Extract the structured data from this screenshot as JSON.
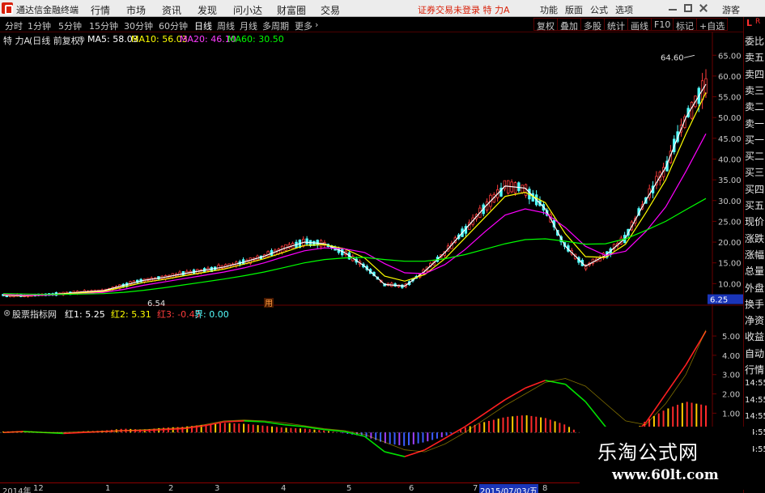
{
  "topbar": {
    "app_title": "通达信金融终端",
    "menus": [
      "行情",
      "市场",
      "资讯",
      "发现",
      "问小达",
      "财富圈",
      "交易"
    ],
    "notice": "证券交易未登录 特 力A",
    "right_menus": [
      "功能",
      "版面",
      "公式",
      "选项"
    ],
    "guest": "游客"
  },
  "periodbar": {
    "periods": [
      "分时",
      "1分钟",
      "5分钟",
      "15分钟",
      "30分钟",
      "60分钟",
      "日线",
      "周线",
      "月线",
      "多周期",
      "更多"
    ],
    "active": "日线",
    "more_arrow": "›",
    "right_buttons": [
      "复权",
      "叠加",
      "多股",
      "统计",
      "画线",
      "F10",
      "标记",
      "+自选"
    ],
    "corner": "L",
    "corner_sub": "R"
  },
  "chart_header": {
    "stock": "特 力A",
    "adj": "(日线 前复权)",
    "ma5": "MA5: 58.03",
    "ma10": "MA10: 56.03",
    "ma20": "MA20: 46.10",
    "ma60": "MA60: 30.50"
  },
  "indicator_header": {
    "name": "股票指标网",
    "red1": "红1: 5.25",
    "red2": "红2: 5.31",
    "red3": "红3: -0.43",
    "jie": "界: 0.00"
  },
  "price_axis": {
    "ticks": [
      "65.00",
      "60.00",
      "55.00",
      "50.00",
      "45.00",
      "40.00",
      "35.00",
      "30.00",
      "25.00",
      "20.00",
      "15.00",
      "10.00"
    ],
    "current": "6.25"
  },
  "indicator_axis": {
    "ticks": [
      "5.00",
      "4.00",
      "3.00",
      "2.00",
      "1.00"
    ]
  },
  "annotations": {
    "high": "64.60",
    "low": "6.54",
    "marker": "用"
  },
  "right_column": [
    "委比",
    "卖五",
    "卖四",
    "卖三",
    "卖二",
    "卖一",
    "买一",
    "买二",
    "买三",
    "买四",
    "买五",
    "现价",
    "涨跌",
    "涨幅",
    "总量",
    "外盘",
    "换手",
    "净资",
    "收益",
    "自动",
    "行情",
    "14:55",
    "14:55",
    "14:55",
    "14:55",
    "14:55"
  ],
  "x_axis": {
    "labels": [
      "2014年",
      "12",
      "1",
      "2",
      "3",
      "4",
      "5",
      "6",
      "7",
      "8"
    ],
    "cursor_date": "2015/07/03/五"
  },
  "watermark": {
    "cn": "乐淘公式网",
    "url": "www.60lt.com"
  },
  "colors": {
    "up": "#ff3c3c",
    "down": "#54ffff",
    "ma5": "#ffffff",
    "ma10": "#ffff00",
    "ma20": "#ff00ff",
    "ma60": "#00ff00",
    "ind_red": "#ff2020",
    "ind_green": "#00e000",
    "grid": "#6a0000"
  },
  "chart_data": [
    {
      "type": "candlestick",
      "title": "特 力A (日线 前复权)",
      "xlabel": "",
      "ylabel": "",
      "ylim": [
        5,
        67
      ],
      "x_labels": [
        "2014年",
        "12",
        "1",
        "2",
        "3",
        "4",
        "5",
        "6",
        "7",
        "8"
      ],
      "series": [
        {
          "name": "MA5",
          "values": [
            7.2,
            7.0,
            7.3,
            7.6,
            8.0,
            8.3,
            9.6,
            10.8,
            11.5,
            12.4,
            13.2,
            14.0,
            15.2,
            16.6,
            18.5,
            20.0,
            19.6,
            17.5,
            14.2,
            9.8,
            9.4,
            13.0,
            17.5,
            23.0,
            28.5,
            33.5,
            33.0,
            28.0,
            19.0,
            14.2,
            16.8,
            21.0,
            30.0,
            38.0,
            50.0,
            58.03
          ]
        },
        {
          "name": "MA10",
          "values": [
            7.3,
            7.1,
            7.2,
            7.5,
            7.8,
            8.1,
            9.2,
            10.3,
            11.0,
            11.9,
            12.7,
            13.5,
            14.7,
            16.0,
            17.6,
            19.2,
            19.4,
            18.4,
            16.2,
            11.8,
            10.6,
            12.2,
            16.0,
            21.0,
            26.0,
            31.0,
            32.0,
            29.5,
            22.0,
            16.5,
            16.3,
            19.5,
            27.0,
            35.0,
            46.0,
            56.03
          ]
        },
        {
          "name": "MA20",
          "values": [
            7.4,
            7.2,
            7.2,
            7.4,
            7.6,
            7.9,
            8.6,
            9.6,
            10.4,
            11.2,
            12.0,
            12.8,
            13.8,
            15.0,
            16.5,
            17.9,
            18.6,
            18.4,
            17.5,
            14.8,
            12.6,
            12.4,
            14.6,
            18.2,
            22.5,
            26.5,
            28.0,
            27.0,
            23.5,
            19.0,
            16.8,
            17.8,
            22.5,
            28.5,
            37.0,
            46.1
          ]
        },
        {
          "name": "MA60",
          "values": [
            7.6,
            7.5,
            7.4,
            7.4,
            7.5,
            7.6,
            7.9,
            8.4,
            9.0,
            9.7,
            10.4,
            11.1,
            11.9,
            12.8,
            13.9,
            15.0,
            15.8,
            16.2,
            16.3,
            15.8,
            15.4,
            15.4,
            16.0,
            17.0,
            18.3,
            19.6,
            20.6,
            20.8,
            20.2,
            19.5,
            19.6,
            20.8,
            22.8,
            25.0,
            27.8,
            30.5
          ]
        }
      ],
      "high_label": 64.6,
      "low_label": 6.54,
      "current": 6.25
    },
    {
      "type": "line",
      "title": "股票指标网",
      "xlabel": "",
      "ylabel": "",
      "ylim": [
        -1.5,
        5.8
      ],
      "series": [
        {
          "name": "红1",
          "values": [
            0.0,
            0.05,
            0.0,
            -0.05,
            0.0,
            0.05,
            0.1,
            0.1,
            0.15,
            0.2,
            0.35,
            0.55,
            0.6,
            0.55,
            0.4,
            0.3,
            0.15,
            0.05,
            -0.2,
            -1.0,
            -1.25,
            -0.9,
            -0.3,
            0.3,
            1.0,
            1.7,
            2.3,
            2.7,
            2.5,
            1.6,
            0.3,
            -0.5,
            0.5,
            2.0,
            3.5,
            5.25
          ]
        },
        {
          "name": "红2",
          "values": [
            0.0,
            0.05,
            0.0,
            0.0,
            0.05,
            0.05,
            0.1,
            0.15,
            0.2,
            0.25,
            0.4,
            0.6,
            0.65,
            0.6,
            0.5,
            0.35,
            0.2,
            0.1,
            -0.1,
            -0.5,
            -0.9,
            -1.0,
            -0.6,
            0.0,
            0.7,
            1.4,
            2.0,
            2.6,
            2.8,
            2.4,
            1.5,
            0.6,
            0.4,
            1.5,
            3.0,
            5.31
          ]
        },
        {
          "name": "界",
          "values": [
            0,
            0,
            0,
            0,
            0,
            0,
            0,
            0,
            0,
            0,
            0,
            0,
            0,
            0,
            0,
            0,
            0,
            0,
            0,
            0,
            0,
            0,
            0,
            0,
            0,
            0,
            0,
            0,
            0,
            0,
            0,
            0,
            0,
            0,
            0,
            0
          ]
        }
      ],
      "bars": [
        0.05,
        0.08,
        0.03,
        -0.05,
        0.06,
        0.1,
        0.2,
        0.15,
        0.25,
        0.3,
        0.4,
        0.5,
        0.45,
        0.35,
        0.25,
        0.2,
        0.1,
        -0.05,
        -0.2,
        -0.55,
        -0.7,
        -0.5,
        -0.2,
        0.25,
        0.55,
        0.8,
        0.9,
        0.75,
        0.4,
        -0.2,
        -0.5,
        -0.3,
        0.6,
        1.2,
        1.6,
        1.4
      ]
    }
  ]
}
